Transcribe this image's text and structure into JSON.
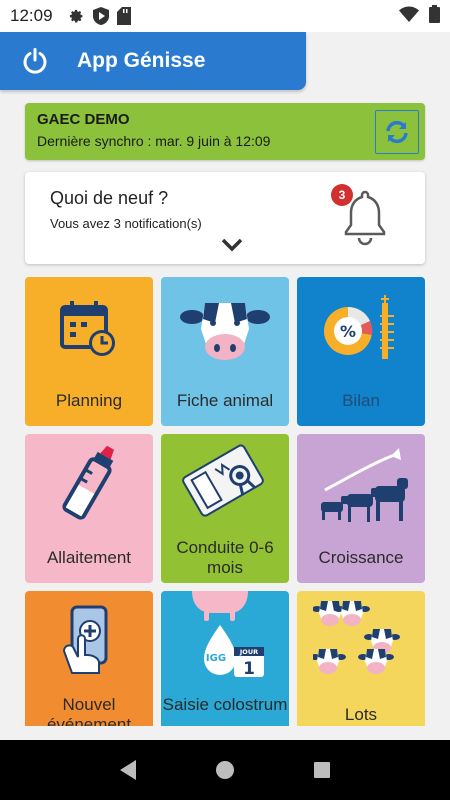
{
  "status_bar": {
    "time": "12:09",
    "icons": [
      "settings-icon",
      "shield-play-icon",
      "sd-card-icon",
      "wifi-icon",
      "battery-icon"
    ]
  },
  "app_bar": {
    "title": "App Génisse",
    "color": "#2a7bcf"
  },
  "farm_card": {
    "name": "GAEC DEMO",
    "last_sync": "Dernière synchro : mar. 9 juin à 12:09",
    "color": "#8cc23b"
  },
  "news_card": {
    "title": "Quoi de neuf ?",
    "subtitle": "Vous avez 3 notification(s)",
    "badge_count": "3"
  },
  "tiles": [
    {
      "label": "Planning",
      "color": "#f7af2a",
      "icon": "calendar-clock-icon"
    },
    {
      "label": "Fiche animal",
      "color": "#6ec3e6",
      "icon": "cow-head-icon"
    },
    {
      "label": "Bilan",
      "color": "#1083cc",
      "icon": "percent-chart-icon"
    },
    {
      "label": "Allaitement",
      "color": "#f6b7c9",
      "icon": "baby-bottle-icon"
    },
    {
      "label": "Conduite 0-6 mois",
      "color": "#92c233",
      "icon": "card-ribbon-icon"
    },
    {
      "label": "Croissance",
      "color": "#c8a4d4",
      "icon": "calves-growth-icon"
    },
    {
      "label": "Nouvel événement",
      "color": "#f28c30",
      "icon": "hand-phone-plus-icon"
    },
    {
      "label": "Saisie colostrum",
      "color": "#2aa8d6",
      "icon": "udder-igg-icon"
    },
    {
      "label": "Lots",
      "color": "#f5d65c",
      "icon": "cow-group-icon"
    }
  ],
  "tile_label_colors": {
    "dark": "#2b2b2b",
    "on_blue": "#1e4f77"
  }
}
